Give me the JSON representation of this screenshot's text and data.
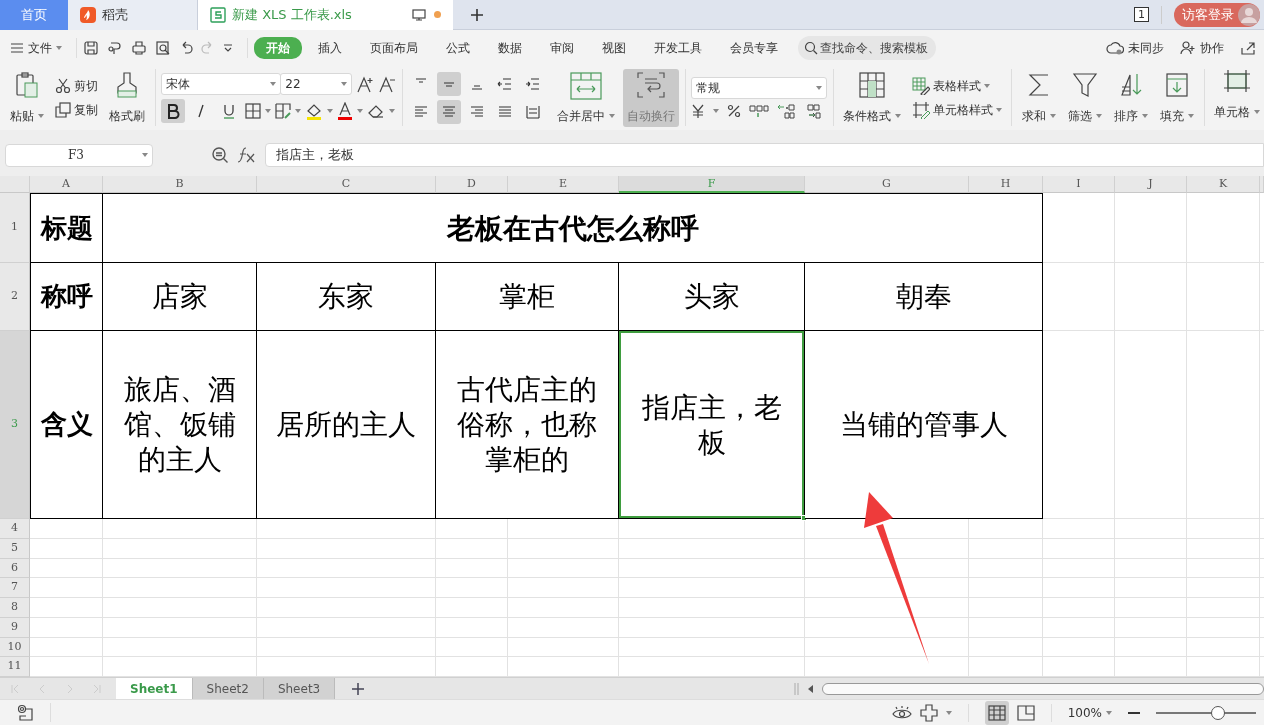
{
  "tabs": [
    {
      "kind": "home",
      "label": "首页",
      "selected": false
    },
    {
      "kind": "docer",
      "label": "稻壳",
      "selected": false
    },
    {
      "kind": "sheet",
      "label": "新建 XLS 工作表.xls",
      "selected": true
    }
  ],
  "window_controls": {
    "page_count": "1",
    "login": "访客登录"
  },
  "menu": {
    "file": "文件",
    "tabs": [
      {
        "label": "开始",
        "selected": true
      },
      {
        "label": "插入",
        "selected": false
      },
      {
        "label": "页面布局",
        "selected": false
      },
      {
        "label": "公式",
        "selected": false
      },
      {
        "label": "数据",
        "selected": false
      },
      {
        "label": "审阅",
        "selected": false
      },
      {
        "label": "视图",
        "selected": false
      },
      {
        "label": "开发工具",
        "selected": false
      },
      {
        "label": "会员专享",
        "selected": false
      }
    ],
    "search": {
      "placeholder": "查找命令、搜索模板"
    },
    "sync": "未同步",
    "collaborate": "协作"
  },
  "ribbon": {
    "paste": "粘贴",
    "cut": "剪切",
    "copy": "复制",
    "format_painter": "格式刷",
    "font": "宋体",
    "font_size": "22",
    "bold": true,
    "italic": false,
    "underline": false,
    "align_buttons": [
      {
        "kind": "top",
        "selected": false
      },
      {
        "kind": "middle",
        "selected": true
      },
      {
        "kind": "bottom",
        "selected": false
      },
      {
        "kind": "outdent",
        "selected": false
      },
      {
        "kind": "indent",
        "selected": false
      },
      {
        "kind": "left",
        "selected": false
      },
      {
        "kind": "center",
        "selected": true
      },
      {
        "kind": "right",
        "selected": false
      },
      {
        "kind": "justify",
        "selected": false
      },
      {
        "kind": "distributed",
        "selected": false
      }
    ],
    "merge_center": "合并居中",
    "wrap_text": {
      "label": "自动换行",
      "on": true
    },
    "number_format": "常规",
    "conditional_format": "条件格式",
    "table_style": "表格样式",
    "cell_style": "单元格样式",
    "sum": "求和",
    "filter": "筛选",
    "sort": "排序",
    "fill": "填充",
    "cell": "单元格"
  },
  "formula_bar": {
    "name_box": "F3",
    "formula": "指店主，老板"
  },
  "sheet": {
    "columns": [
      {
        "label": "A",
        "selected": false
      },
      {
        "label": "B",
        "selected": false
      },
      {
        "label": "C",
        "selected": false
      },
      {
        "label": "D",
        "selected": false
      },
      {
        "label": "E",
        "selected": false
      },
      {
        "label": "F",
        "selected": true
      },
      {
        "label": "G",
        "selected": false
      },
      {
        "label": "H",
        "selected": false
      },
      {
        "label": "I",
        "selected": false
      },
      {
        "label": "J",
        "selected": false
      },
      {
        "label": "K",
        "selected": false
      }
    ],
    "rows": [
      {
        "label": "1",
        "selected": false
      },
      {
        "label": "2",
        "selected": false
      },
      {
        "label": "3",
        "selected": true
      },
      {
        "label": "4",
        "selected": false
      },
      {
        "label": "5",
        "selected": false
      },
      {
        "label": "6",
        "selected": false
      },
      {
        "label": "7",
        "selected": false
      },
      {
        "label": "8",
        "selected": false
      },
      {
        "label": "9",
        "selected": false
      },
      {
        "label": "10",
        "selected": false
      },
      {
        "label": "11",
        "selected": false
      }
    ],
    "cells": [
      {
        "text": "标题",
        "bold": true,
        "selected": false
      },
      {
        "text": "老板在古代怎么称呼",
        "bold": true,
        "selected": false
      },
      {
        "text": "称呼",
        "bold": true,
        "selected": false
      },
      {
        "text": "店家",
        "bold": false,
        "selected": false
      },
      {
        "text": "东家",
        "bold": false,
        "selected": false
      },
      {
        "text": "掌柜",
        "bold": false,
        "selected": false
      },
      {
        "text": "头家",
        "bold": false,
        "selected": false
      },
      {
        "text": "朝奉",
        "bold": false,
        "selected": false
      },
      {
        "text": "含义",
        "bold": true,
        "selected": false
      },
      {
        "text": "旅店、酒馆、饭铺的主人",
        "bold": false,
        "selected": false
      },
      {
        "text": "居所的主人",
        "bold": false,
        "selected": false
      },
      {
        "text": "古代店主的俗称，也称掌柜的",
        "bold": false,
        "selected": false
      },
      {
        "text": "指店主，老板",
        "bold": false,
        "selected": true
      },
      {
        "text": "当铺的管事人",
        "bold": false,
        "selected": false
      }
    ]
  },
  "sheet_tabs": [
    {
      "label": "Sheet1",
      "selected": true
    },
    {
      "label": "Sheet2",
      "selected": false
    },
    {
      "label": "Sheet3",
      "selected": false
    }
  ],
  "status_bar": {
    "zoom": "100%",
    "zoom_slider": {
      "level": 0.62
    }
  }
}
